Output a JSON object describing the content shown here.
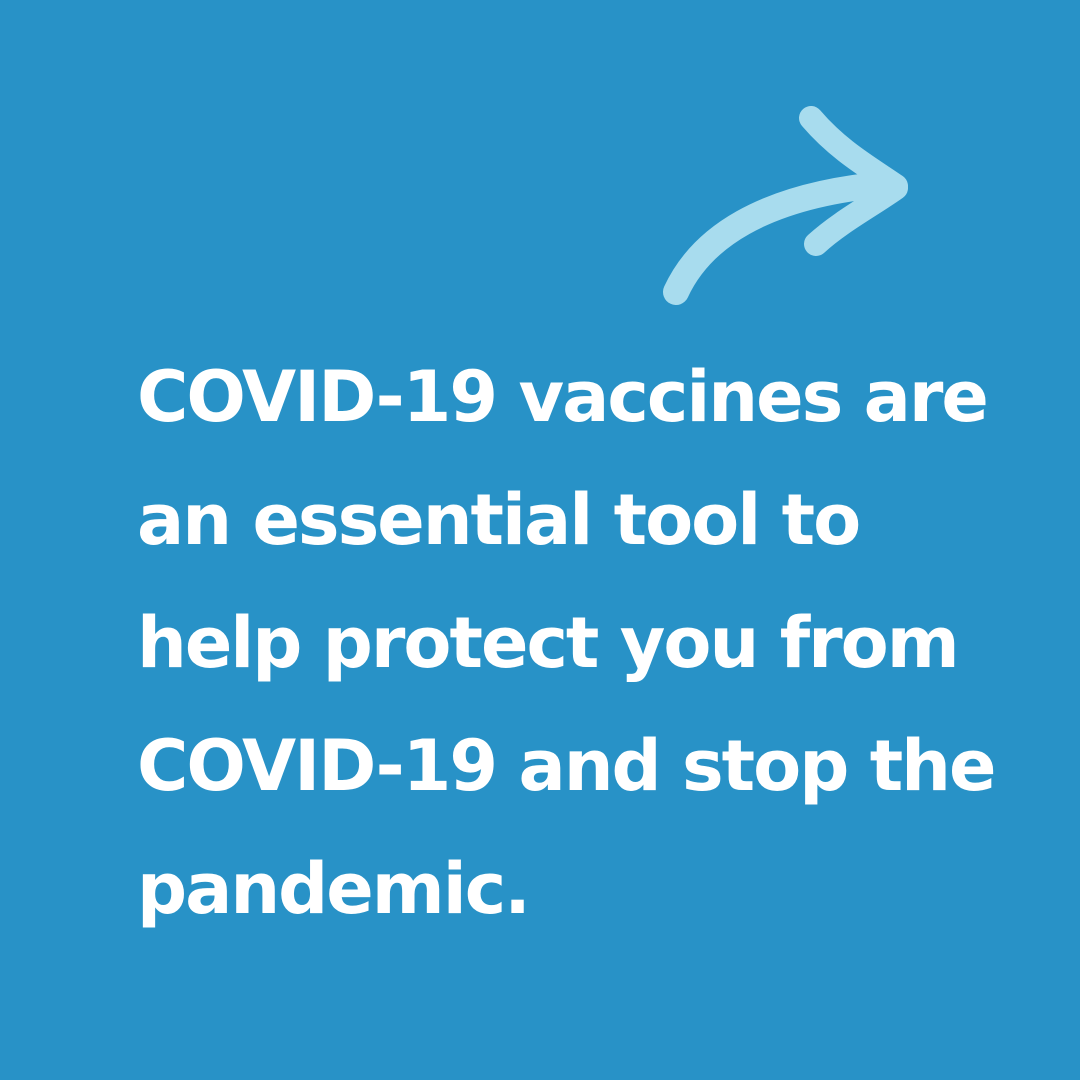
{
  "background_color": "#2892c7",
  "arrow": {
    "icon": "arrow-up-right-icon",
    "color": "#a8dcee"
  },
  "message": {
    "lines": [
      "COVID-19 vaccines are",
      "an essential tool to",
      "help protect you from",
      "COVID-19 and stop the",
      "pandemic."
    ]
  }
}
